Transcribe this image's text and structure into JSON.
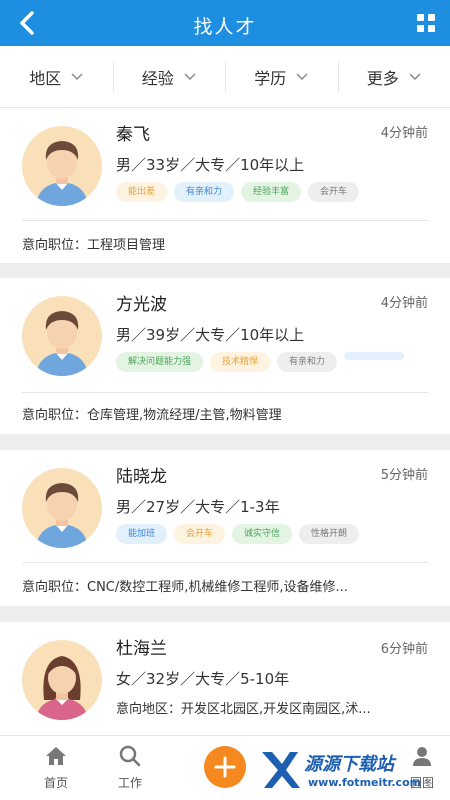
{
  "header": {
    "title": "找人才"
  },
  "filters": [
    "地区",
    "经验",
    "学历",
    "更多"
  ],
  "candidates": [
    {
      "name": "秦飞",
      "time": "4分钟前",
      "info": "男／33岁／大专／10年以上",
      "tags": [
        {
          "label": "能出差",
          "color": "#e6a23c",
          "bg": "#fdf3e0"
        },
        {
          "label": "有亲和力",
          "color": "#3b86d6",
          "bg": "#e2f0fb"
        },
        {
          "label": "经验丰富",
          "color": "#4aa35a",
          "bg": "#e4f4e3"
        },
        {
          "label": "会开车",
          "color": "#777777",
          "bg": "#eeeeee"
        }
      ],
      "intent": "意向职位：工程项目管理",
      "gender": "male"
    },
    {
      "name": "方光波",
      "time": "4分钟前",
      "info": "男／39岁／大专／10年以上",
      "tags": [
        {
          "label": "解决问题能力强",
          "color": "#4aa35a",
          "bg": "#e4f4e3"
        },
        {
          "label": "技术精悍",
          "color": "#e6a23c",
          "bg": "#fdf3e0"
        },
        {
          "label": "有亲和力",
          "color": "#777777",
          "bg": "#eeeeee"
        },
        {
          "label": "",
          "color": "#3b86d6",
          "bg": "#e2f0fb"
        }
      ],
      "intent": "意向职位：仓库管理,物流经理/主管,物料管理",
      "gender": "male"
    },
    {
      "name": "陆晓龙",
      "time": "5分钟前",
      "info": "男／27岁／大专／1-3年",
      "tags": [
        {
          "label": "能加班",
          "color": "#3b86d6",
          "bg": "#e2f0fb"
        },
        {
          "label": "会开车",
          "color": "#e6a23c",
          "bg": "#fdf3e0"
        },
        {
          "label": "诚实守信",
          "color": "#4aa35a",
          "bg": "#e4f4e3"
        },
        {
          "label": "性格开朗",
          "color": "#777777",
          "bg": "#eeeeee"
        }
      ],
      "intent": "意向职位：CNC/数控工程师,机械维修工程师,设备维修...",
      "gender": "male"
    },
    {
      "name": "杜海兰",
      "time": "6分钟前",
      "info": "女／32岁／大专／5-10年",
      "info2": "意向地区：开发区北园区,开发区南园区,沭...",
      "gender": "female"
    }
  ],
  "tabbar": {
    "home": "首页",
    "jobs": "工作",
    "right_text": "圆图"
  },
  "watermark": {
    "line1": "源源下载站",
    "line2": "www.fotmeitr.com"
  },
  "colors": {
    "primary": "#1e8fe0",
    "accent": "#f5891f"
  }
}
